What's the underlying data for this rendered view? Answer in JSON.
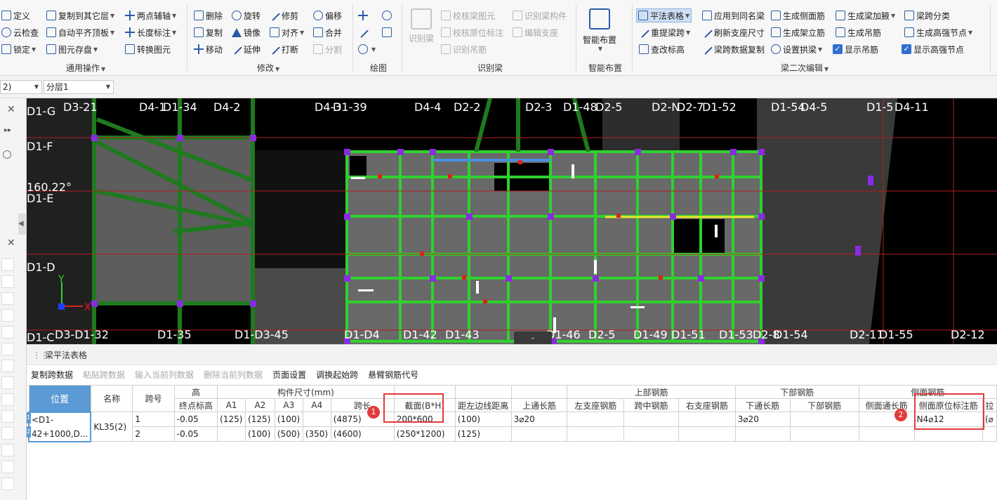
{
  "ribbon": {
    "general": {
      "define": "定义",
      "copy_to_floor": "复制到其它层",
      "two_point_axis": "两点辅轴",
      "cloud_check": "云检查",
      "auto_align_top": "自动平齐顶板",
      "length_dim": "长度标注",
      "lock": "锁定",
      "save_element": "图元存盘",
      "convert_element": "转换图元",
      "label": "通用操作"
    },
    "modify": {
      "delete": "删除",
      "rotate": "旋转",
      "trim": "修剪",
      "offset": "偏移",
      "copy": "复制",
      "mirror": "镜像",
      "align": "对齐",
      "merge": "合并",
      "move": "移动",
      "extend": "延伸",
      "break": "打断",
      "split": "分割",
      "label": "修改"
    },
    "draw": {
      "label": "绘图"
    },
    "recognize": {
      "recognize_beam": "识别梁",
      "check_beam_elem": "校核梁图元",
      "recognize_beam_comp": "识别梁构件",
      "check_origin_dim": "校核原位标注",
      "edit_support": "编辑支座",
      "recognize_hanger": "识别吊筋",
      "label": "识别梁"
    },
    "smart": {
      "smart_layout": "智能布置",
      "label": "智能布置"
    },
    "beam_edit": {
      "flat_table": "平法表格",
      "apply_same_name": "应用到同名梁",
      "gen_side_rebar": "生成侧面筋",
      "gen_haunch": "生成梁加腋",
      "span_class": "梁跨分类",
      "re_extract_span": "重提梁跨",
      "refresh_support": "刷新支座尺寸",
      "gen_stirrup": "生成架立筋",
      "gen_hanger": "生成吊筋",
      "gen_strong_node": "生成高强节点",
      "check_elevation": "查改标高",
      "copy_span_data": "梁跨数据复制",
      "set_arch": "设置拱梁",
      "show_hanger": "显示吊筋",
      "show_strong_node": "显示高强节点",
      "label": "梁二次编辑"
    }
  },
  "selectors": {
    "floor_value": "2)",
    "layer_value": "分层1"
  },
  "canvas": {
    "angle": "160.22°",
    "axis_labels_left": [
      "D1-G",
      "D1-F",
      "D1-E",
      "D1-D",
      "D1-C"
    ],
    "top_labels": [
      "D3-21",
      "D4-1",
      "D1-34",
      "D4-2",
      "D4-3",
      "D1-39",
      "D4-4",
      "D2-2",
      "D2-3",
      "D1-48",
      "D2-5",
      "D2-N",
      "D2-7",
      "D1-52",
      "D1-54",
      "D4-5",
      "D1-5",
      "D4-11"
    ],
    "bottom_labels": [
      "D3-D1-32",
      "D1-35",
      "D1-D3-45",
      "D1-D4",
      "D1-42",
      "D1-43",
      "D1-46",
      "D2-5",
      "D1-49",
      "D1-51",
      "D1-53",
      "D2-8",
      "D1-54",
      "D2-11",
      "D1-55",
      "D2-12"
    ],
    "axis_x": "X",
    "axis_y": "Y"
  },
  "panel": {
    "title": "梁平法表格",
    "toolbar": [
      "复制跨数据",
      "粘贴跨数据",
      "输入当前列数据",
      "删除当前列数据",
      "页面设置",
      "调换起始跨",
      "悬臂钢筋代号"
    ],
    "toolbar_disabled": [
      false,
      true,
      true,
      true,
      false,
      false,
      false
    ],
    "headers": {
      "position": "位置",
      "name": "名称",
      "span_no": "跨号",
      "elevation_group": "高",
      "end_elevation": "终点标高",
      "dims_group": "构件尺寸(mm)",
      "a1": "A1",
      "a2": "A2",
      "a3": "A3",
      "a4": "A4",
      "span_len": "跨长",
      "section": "截面(B*H)",
      "edge_dist": "距左边线距离",
      "top_through": "上通长筋",
      "top_rebar_group": "上部钢筋",
      "left_support": "左支座钢筋",
      "mid_span": "跨中钢筋",
      "right_support": "右支座钢筋",
      "bottom_rebar_group": "下部钢筋",
      "bottom_through": "下通长筋",
      "bottom_rebar": "下部钢筋",
      "side_group": "侧面钢筋",
      "side_through": "侧面通长筋",
      "side_origin": "侧面原位标注筋",
      "extra": "拉"
    },
    "rows": [
      {
        "idx": "1",
        "position": "<D1-42+1000,D...",
        "name": "KL35(2)",
        "span": "1",
        "end_elev": "-0.05",
        "a1": "(125)",
        "a2": "(125)",
        "a3": "(100)",
        "a4": "",
        "span_len": "(4875)",
        "section": "200*600",
        "edge": "(100)",
        "top_through": "3⌀20",
        "left_sup": "",
        "mid": "",
        "right_sup": "",
        "bottom_through": "3⌀20",
        "bottom": "",
        "side_through": "",
        "side_origin": "N4⌀12",
        "extra": "(⌀"
      },
      {
        "idx": "2",
        "position": "",
        "name": "",
        "span": "2",
        "end_elev": "-0.05",
        "a1": "",
        "a2": "(100)",
        "a3": "(500)",
        "a4": "(350)",
        "span_len": "(4600)",
        "section": "(250*1200)",
        "edge": "(125)",
        "top_through": "",
        "left_sup": "",
        "mid": "",
        "right_sup": "",
        "bottom_through": "",
        "bottom": "",
        "side_through": "",
        "side_origin": "",
        "extra": ""
      }
    ],
    "badges": [
      "1",
      "2"
    ]
  }
}
